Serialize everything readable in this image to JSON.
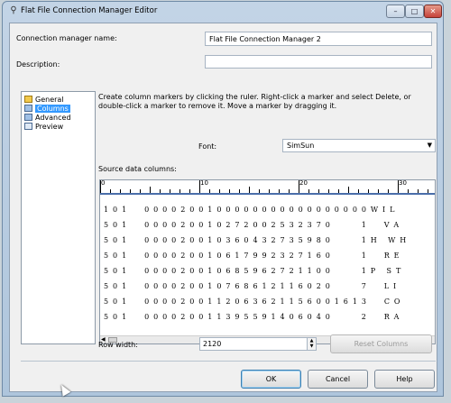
{
  "window": {
    "title": "Flat File Connection Manager Editor",
    "controls": {
      "minimize": "–",
      "maximize": "□",
      "close": "✕"
    }
  },
  "form": {
    "name_label": "Connection manager name:",
    "name_value": "Flat File Connection Manager 2",
    "description_label": "Description:",
    "description_value": ""
  },
  "nav": {
    "items": [
      {
        "label": "General",
        "icon": "general-icon",
        "selected": false
      },
      {
        "label": "Columns",
        "icon": "columns-icon",
        "selected": true
      },
      {
        "label": "Advanced",
        "icon": "advanced-icon",
        "selected": false
      },
      {
        "label": "Preview",
        "icon": "preview-icon",
        "selected": false
      }
    ]
  },
  "columns_page": {
    "description": "Create column markers by clicking the ruler. Right-click a marker and select Delete, or double-click a marker to remove it. Move a marker by dragging it.",
    "font_label": "Font:",
    "font_value": "SimSun",
    "source_label": "Source data columns:",
    "ruler_labels": [
      "0",
      "10",
      "20",
      "30"
    ],
    "rows": [
      "1 0 1     0 0 0 0 2 0 0 1 0 0 0 0 0 0 0 0 0 0 0 0 0 0 0 0 0 W I L",
      "5 0 1     0 0 0 0 2 0 0 1 0 2 7 2 0 0 2 5 3 2 3 7 0         1     V A",
      "5 0 1     0 0 0 0 2 0 0 1 0 3 6 0 4 3 2 7 3 5 9 8 0         1 H   W H",
      "5 0 1     0 0 0 0 2 0 0 1 0 6 1 7 9 9 2 3 2 7 1 6 0         1     R E",
      "5 0 1     0 0 0 0 2 0 0 1 0 6 8 5 9 6 2 7 2 1 1 0 0         1 P   S T",
      "5 0 1     0 0 0 0 2 0 0 1 0 7 6 8 6 1 2 1 1 6 0 2 0         7     L I",
      "5 0 1     0 0 0 0 2 0 0 1 1 2 0 6 3 6 2 1 1 5 6 0 0 1 6 1 3     C O",
      "5 0 1     0 0 0 0 2 0 0 1 1 3 9 5 5 9 1 4 0 6 0 4 0         2     R A"
    ],
    "row_width_label": "Row width:",
    "row_width_value": "2120",
    "reset_button": "Reset Columns"
  },
  "footer": {
    "ok": "OK",
    "cancel": "Cancel",
    "help": "Help"
  }
}
